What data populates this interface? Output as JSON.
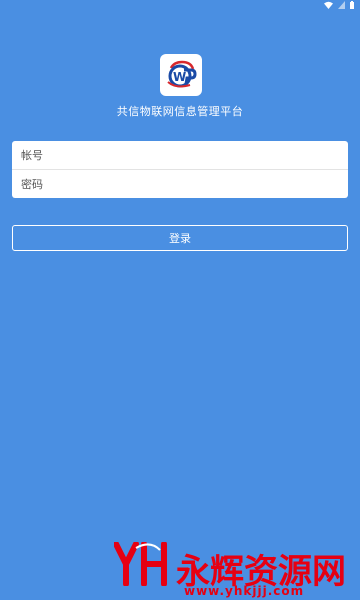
{
  "app": {
    "title": "共信物联网信息管理平台"
  },
  "logo": {
    "icon": "app-logo-icon",
    "accent": "#1a4aa6",
    "secondary": "#d8282c"
  },
  "login_form": {
    "account_placeholder": "帐号",
    "password_placeholder": "密码",
    "account_value": "",
    "password_value": ""
  },
  "actions": {
    "login_label": "登录"
  },
  "watermark": {
    "text": "永辉资源网",
    "url": "www.yhkjjj.com",
    "color": "#e60012"
  },
  "colors": {
    "background": "#4a8fe2",
    "card": "#ffffff",
    "button_border": "#ffffff"
  }
}
